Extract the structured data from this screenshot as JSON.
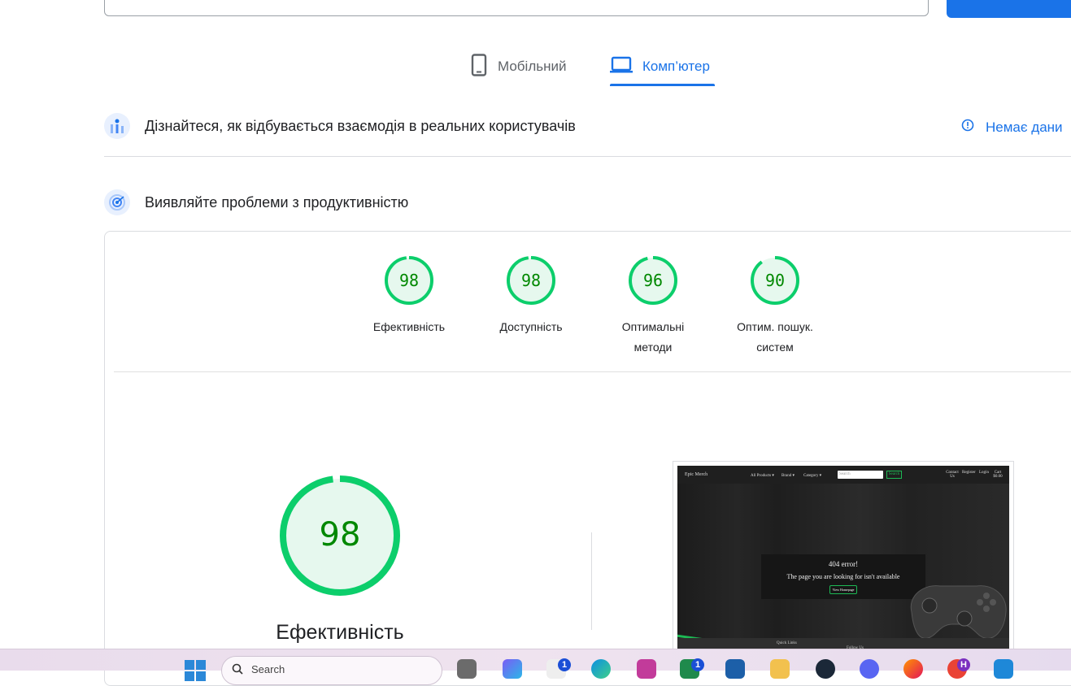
{
  "tabs": {
    "mobile_label": "Мобільний",
    "desktop_label": "Комп’ютер"
  },
  "field_data": {
    "title": "Дізнайтеся, як відбувається взаємодія в реальних користувачів",
    "no_data_label": "Немає дани"
  },
  "lab_data": {
    "title": "Виявляйте проблеми з продуктивністю"
  },
  "scores": [
    {
      "value": "98",
      "label": "Ефективність",
      "fraction": 0.98
    },
    {
      "value": "98",
      "label": "Доступність",
      "fraction": 0.98
    },
    {
      "value": "96",
      "label": "Оптимальні методи",
      "fraction": 0.96
    },
    {
      "value": "90",
      "label": "Оптим. пошук. систем",
      "fraction": 0.9
    }
  ],
  "main_score": {
    "value": "98",
    "label": "Ефективність",
    "fraction": 0.98
  },
  "colors": {
    "accent": "#1a73e8",
    "score_good": "#0cce6b",
    "score_good_text": "#008800",
    "score_good_fill": "#e6f8ee"
  },
  "preview": {
    "brand": "Epic Merch",
    "nav_all_products": "All Products ▾",
    "nav_brand": "Brand ▾",
    "nav_category": "Category ▾",
    "search_placeholder": "Search",
    "search_button": "Search",
    "nav_contact": "Contact Us",
    "nav_register": "Register",
    "nav_login": "Login",
    "nav_cart": "Cart $0.00",
    "error_title": "404 error!",
    "error_message": "The page you are looking for isn't available",
    "homepage_button": "View Homepage",
    "footer_quick_links": "Quick Links",
    "footer_follow": "Follow Us"
  },
  "taskbar": {
    "search_placeholder": "Search",
    "badge_1": "1",
    "badge_2": "1",
    "avatar_letter": "H"
  }
}
